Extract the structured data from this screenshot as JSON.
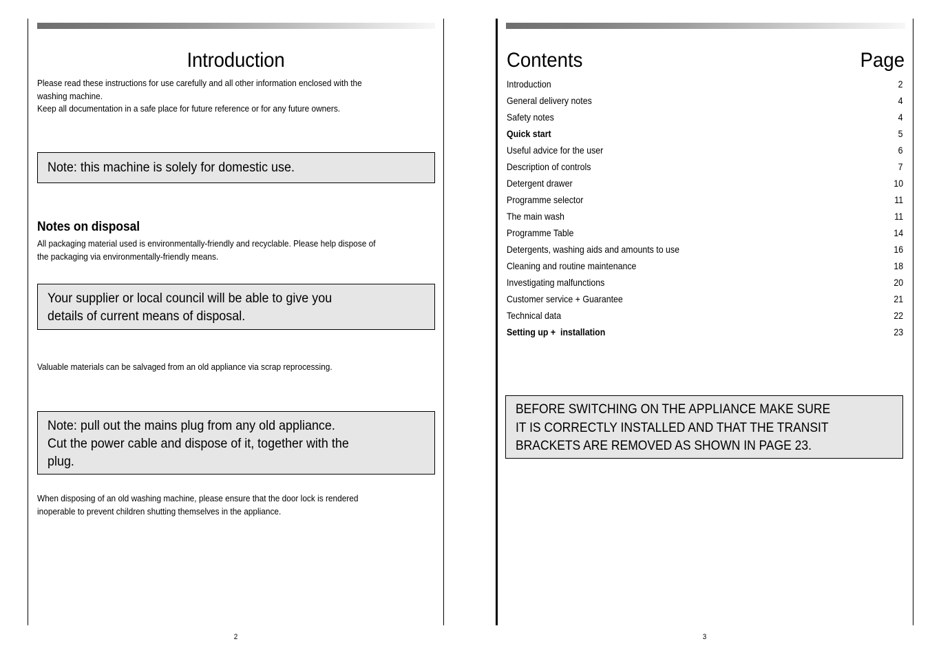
{
  "document": {
    "type": "washing-machine-instruction-manual",
    "spread": "two-page"
  },
  "left_page": {
    "folio": "2",
    "title": "Introduction",
    "intro_paragraph": "Please read these instructions for use carefully and all other information enclosed with the\nwashing machine.\nKeep all documentation in a safe place for future reference or for any future owners.",
    "note_domestic": "Note: this machine is solely for domestic use.",
    "disposal_heading": "Notes on disposal",
    "disposal_paragraph": "All packaging material used is environmentally-friendly and recyclable. Please help dispose of\nthe packaging via environmentally-friendly means.",
    "note_supplier": "Your supplier or local council will be able to give you\ndetails of current means of disposal.",
    "salvage_paragraph": "Valuable materials can be salvaged from an old appliance via scrap reprocessing.",
    "note_plug": "Note: pull out the mains plug from any old appliance.\nCut the power cable and dispose of it, together with the\nplug.",
    "door_lock_paragraph": "When disposing of an old washing machine, please ensure that the door lock is rendered\ninoperable to prevent children shutting themselves in the appliance."
  },
  "right_page": {
    "folio": "3",
    "title": "Contents",
    "page_column_header": "Page",
    "entries": [
      {
        "label": "Introduction",
        "page": "2",
        "bold": false
      },
      {
        "label": "General delivery notes",
        "page": "4",
        "bold": false
      },
      {
        "label": "Safety notes",
        "page": "4",
        "bold": false
      },
      {
        "label": "Quick start",
        "page": "5",
        "bold": true
      },
      {
        "label": "Useful advice for the user",
        "page": "6",
        "bold": false
      },
      {
        "label": "Description of controls",
        "page": "7",
        "bold": false
      },
      {
        "label": "Detergent drawer",
        "page": "10",
        "bold": false
      },
      {
        "label": "Programme selector",
        "page": "11",
        "bold": false
      },
      {
        "label": "The main wash",
        "page": "11",
        "bold": false
      },
      {
        "label": "Programme Table",
        "page": "14",
        "bold": false
      },
      {
        "label": "Detergents, washing aids and amounts to use",
        "page": "16",
        "bold": false
      },
      {
        "label": "Cleaning and routine maintenance",
        "page": "18",
        "bold": false
      },
      {
        "label": "Investigating malfunctions",
        "page": "20",
        "bold": false
      },
      {
        "label": "Customer service + Guarantee",
        "page": "21",
        "bold": false
      },
      {
        "label": "Technical data",
        "page": "22",
        "bold": false
      },
      {
        "label": "Setting up +  installation",
        "page": "23",
        "bold": true
      }
    ],
    "warning_box": "BEFORE SWITCHING ON THE APPLIANCE MAKE SURE\nIT IS CORRECTLY INSTALLED AND THAT THE TRANSIT\nBRACKETS ARE REMOVED AS SHOWN IN PAGE 23."
  },
  "colors": {
    "note_box_fill": "#e6e6e6",
    "note_box_border": "#000000",
    "rule_gradient_start": "#6e6e6e",
    "rule_gradient_end": "#f7f7f7",
    "text": "#000000",
    "page_background": "#ffffff"
  }
}
